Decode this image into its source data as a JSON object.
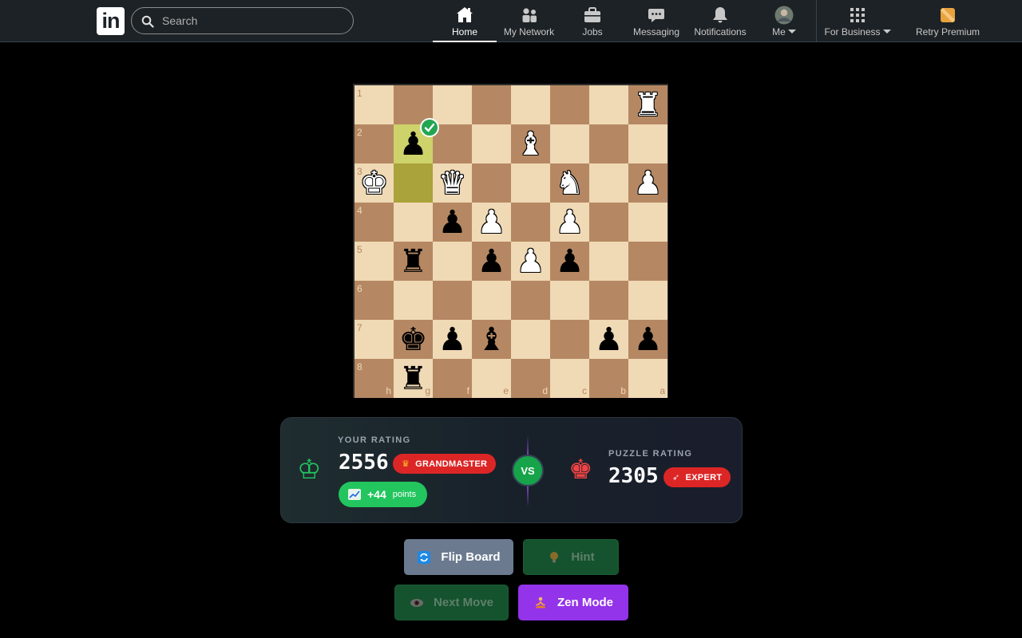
{
  "nav": {
    "logo_text": "in",
    "search_placeholder": "Search",
    "items": [
      {
        "label": "Home",
        "icon": "home-icon",
        "active": true
      },
      {
        "label": "My Network",
        "icon": "network-icon"
      },
      {
        "label": "Jobs",
        "icon": "briefcase-icon"
      },
      {
        "label": "Messaging",
        "icon": "messaging-icon"
      },
      {
        "label": "Notifications",
        "icon": "bell-icon"
      },
      {
        "label": "Me",
        "icon": "avatar"
      },
      {
        "label": "For Business",
        "icon": "grid-icon"
      },
      {
        "label": "Retry Premium",
        "icon": "premium-icon"
      }
    ]
  },
  "board": {
    "rank_labels": [
      "1",
      "2",
      "3",
      "4",
      "5",
      "6",
      "7",
      "8"
    ],
    "file_labels": [
      "h",
      "g",
      "f",
      "e",
      "d",
      "c",
      "b",
      "a"
    ],
    "highlighted_squares": [
      "g2",
      "g3"
    ],
    "pieces": [
      {
        "square": "a1",
        "glyph": "♜",
        "color": "white"
      },
      {
        "square": "g2",
        "glyph": "♟",
        "color": "black",
        "check": true
      },
      {
        "square": "d2",
        "glyph": "♝",
        "color": "white"
      },
      {
        "square": "h3",
        "glyph": "♚",
        "color": "white"
      },
      {
        "square": "f3",
        "glyph": "♛",
        "color": "white"
      },
      {
        "square": "c3",
        "glyph": "♞",
        "color": "white"
      },
      {
        "square": "a3",
        "glyph": "♟",
        "color": "white"
      },
      {
        "square": "f4",
        "glyph": "♟",
        "color": "black"
      },
      {
        "square": "e4",
        "glyph": "♟",
        "color": "white"
      },
      {
        "square": "c4",
        "glyph": "♟",
        "color": "white"
      },
      {
        "square": "g5",
        "glyph": "♜",
        "color": "black"
      },
      {
        "square": "e5",
        "glyph": "♟",
        "color": "black"
      },
      {
        "square": "d5",
        "glyph": "♟",
        "color": "white"
      },
      {
        "square": "c5",
        "glyph": "♟",
        "color": "black"
      },
      {
        "square": "g7",
        "glyph": "♚",
        "color": "black"
      },
      {
        "square": "f7",
        "glyph": "♟",
        "color": "black"
      },
      {
        "square": "e7",
        "glyph": "♝",
        "color": "black"
      },
      {
        "square": "b7",
        "glyph": "♟",
        "color": "black"
      },
      {
        "square": "a7",
        "glyph": "♟",
        "color": "black"
      },
      {
        "square": "g8",
        "glyph": "♜",
        "color": "black"
      }
    ]
  },
  "rating": {
    "your_label": "YOUR RATING",
    "your_value": "2556",
    "your_badge": "GRANDMASTER",
    "points_value": "+44",
    "points_label": "points",
    "vs": "VS",
    "puzzle_label": "PUZZLE RATING",
    "puzzle_value": "2305",
    "puzzle_badge": "EXPERT"
  },
  "buttons": {
    "flip": "Flip Board",
    "hint": "Hint",
    "next": "Next Move",
    "zen": "Zen Mode"
  },
  "colors": {
    "light_square": "#f0d9b5",
    "dark_square": "#b58863",
    "accent_green": "#22c55e",
    "accent_red": "#dc2626",
    "accent_purple": "#9333ea"
  }
}
